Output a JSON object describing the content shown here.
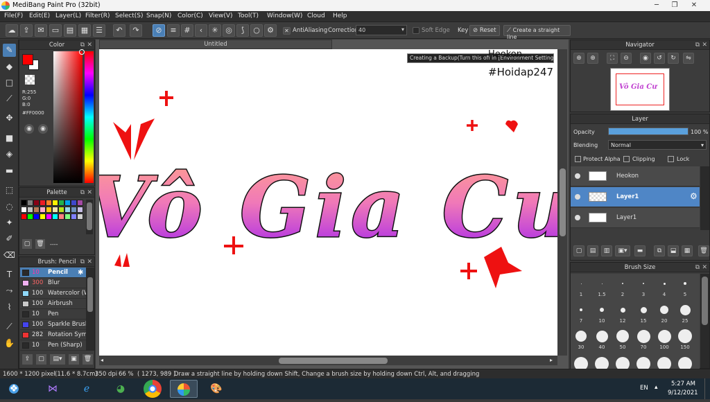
{
  "window": {
    "title": "MediBang Paint Pro (32bit)"
  },
  "menu": [
    "File(F)",
    "Edit(E)",
    "Layer(L)",
    "Filter(R)",
    "Select(S)",
    "Snap(N)",
    "Color(C)",
    "View(V)",
    "Tool(T)",
    "Window(W)",
    "Cloud",
    "Help"
  ],
  "toolbar": {
    "antialiasing_label": "AntiAliasing",
    "correction_label": "Correction",
    "correction_value": "40",
    "soft_edge_label": "Soft Edge",
    "key_label": "Key",
    "reset_label": "Reset",
    "straight_line_label": "Create a straight line"
  },
  "color_panel": {
    "title": "Color",
    "r": "R:255",
    "g": "G:0",
    "b": "B:0",
    "hex": "#FF0000",
    "primary_color": "#ff0000",
    "secondary_color": "#ffffff"
  },
  "palette_panel": {
    "title": "Palette",
    "dashes": "----",
    "swatches": [
      "#000000",
      "#7f7f7f",
      "#880015",
      "#ed1c24",
      "#ff7f27",
      "#fff200",
      "#22b14c",
      "#00a2e8",
      "#3f48cc",
      "#a349a4",
      "#ffffff",
      "#c3c3c3",
      "#b97a57",
      "#ffaec9",
      "#ffc90e",
      "#efe4b0",
      "#b5e61d",
      "#99d9ea",
      "#7092be",
      "#c8bfe7",
      "#ff0000",
      "#00ff00",
      "#0000ff",
      "#ffff00",
      "#ff00ff",
      "#00ffff",
      "#ff8080",
      "#80ff80",
      "#8080ff",
      "#d0d0d0"
    ]
  },
  "brush_panel": {
    "title": "Brush: Pencil",
    "brushes": [
      {
        "size": "10",
        "name": "Pencil",
        "color": "#2a2a2a"
      },
      {
        "size": "300",
        "name": "Blur",
        "color": "#f0b0f0"
      },
      {
        "size": "100",
        "name": "Watercolor (W",
        "color": "#8fd8f8"
      },
      {
        "size": "100",
        "name": "Airbrush",
        "color": "#c8c8c8"
      },
      {
        "size": "10",
        "name": "Pen",
        "color": "#2a2a2a"
      },
      {
        "size": "100",
        "name": "Sparkle Brush",
        "color": "#4444ee"
      },
      {
        "size": "282",
        "name": "Rotation Sym",
        "color": "#ee3333"
      },
      {
        "size": "10",
        "name": "Pen (Sharp)",
        "color": "#2a2a2a"
      }
    ]
  },
  "document": {
    "tab_title": "Untitled",
    "backup_notice": "Creating a Backup(Turn this off in [Environment Settings]",
    "watermark_line1": "Heokon",
    "watermark_line2": "#Hoidap247",
    "artwork_text": "Vô Gia Cư"
  },
  "navigator": {
    "title": "Navigator",
    "thumb_text": "Vô Gia Cư"
  },
  "layer_panel": {
    "title": "Layer",
    "opacity_label": "Opacity",
    "opacity_value": "100 %",
    "opacity_fraction": 1.0,
    "blending_label": "Blending",
    "blending_value": "Normal",
    "protect_alpha_label": "Protect Alpha",
    "clipping_label": "Clipping",
    "lock_label": "Lock",
    "layers": [
      {
        "name": "Heokon",
        "selected": false
      },
      {
        "name": "Layer1",
        "selected": true
      },
      {
        "name": "Layer1",
        "selected": false
      }
    ]
  },
  "brush_size_panel": {
    "title": "Brush Size",
    "sizes": [
      "1",
      "1.5",
      "2",
      "3",
      "4",
      "5",
      "7",
      "10",
      "12",
      "15",
      "20",
      "25",
      "30",
      "40",
      "50",
      "70",
      "100",
      "150"
    ]
  },
  "status": {
    "pixels": "1600 * 1200 pixel",
    "cm": "(11.6 * 8.7cm)",
    "dpi": "350 dpi",
    "zoom": "66 %",
    "coords": "( 1273, 989 )",
    "hint": "Draw a straight line by holding down Shift, Change a brush size by holding down Ctrl, Alt, and dragging"
  },
  "taskbar": {
    "lang": "EN",
    "time": "5:27 AM",
    "date": "9/12/2021"
  }
}
